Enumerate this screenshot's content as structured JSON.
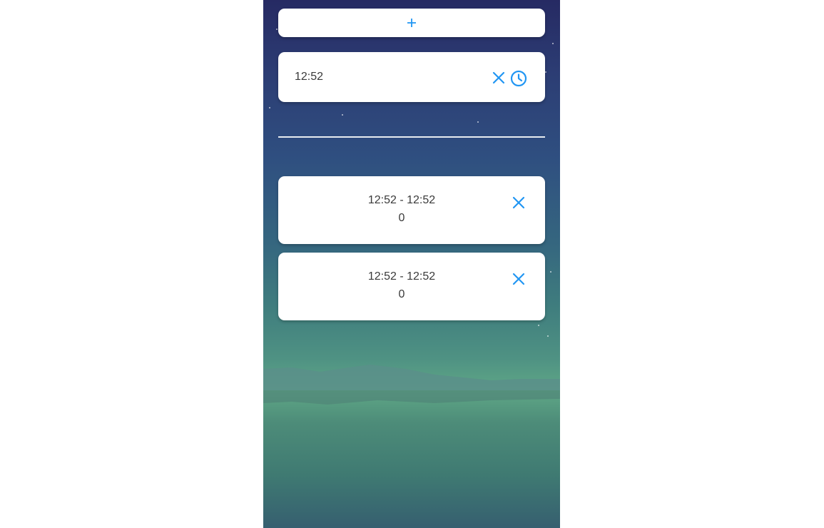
{
  "add_button": {
    "label": "+"
  },
  "time_input": {
    "value": "12:52",
    "clear_icon": "close-icon",
    "picker_icon": "clock-icon"
  },
  "entries": [
    {
      "range": "12:52 - 12:52",
      "count": "0",
      "delete_icon": "close-icon"
    },
    {
      "range": "12:52 - 12:52",
      "count": "0",
      "delete_icon": "close-icon"
    }
  ],
  "colors": {
    "accent": "#2196f3",
    "text": "#3a3a3a",
    "card": "#ffffff"
  }
}
